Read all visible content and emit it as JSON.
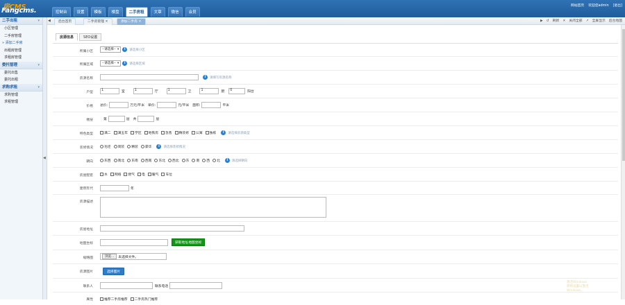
{
  "logo": {
    "top": "房CMS",
    "bottom": "Fangcms."
  },
  "nav": [
    "控制台",
    "设置",
    "模板",
    "楼盘",
    "二手房租",
    "文章",
    "微信",
    "会员"
  ],
  "nav_active_index": 4,
  "toplinks": [
    "网站首页",
    "欢迎您admin",
    "[退出]"
  ],
  "sidebar": [
    {
      "title": "二手出租",
      "items": [
        "小区管理",
        "二手房管理",
        "添加二手房",
        "出租房管理",
        "求租房管理"
      ],
      "active": "添加二手房"
    },
    {
      "title": "委托管理",
      "items": [
        "委托出售",
        "委托出租"
      ]
    },
    {
      "title": "求购求租",
      "items": [
        "求购管理",
        "求租管理"
      ]
    }
  ],
  "page_tabs": [
    "后台首页",
    "二手房管理",
    "添加二手房"
  ],
  "tab_tools": [
    "↺",
    "刷新",
    "✕",
    "关闭全部",
    "↗",
    "全屏显示",
    "后台地图"
  ],
  "subtabs": [
    "房源信息",
    "SEO设置"
  ],
  "form": {
    "community": {
      "label": "所属小区",
      "select": "--请选择--",
      "hint": "请选择小区"
    },
    "region": {
      "label": "所属区域",
      "select": "--请选择--",
      "hint": "请选择区域"
    },
    "title": {
      "label": "房源名称",
      "hint": "请填写房源名称"
    },
    "layout": {
      "label": "户型",
      "units": [
        "室",
        "厅",
        "卫",
        "厨",
        "阳台"
      ],
      "values": [
        "1",
        "1",
        "1",
        "1",
        "0"
      ]
    },
    "price": {
      "label": "价格",
      "total_label": "总价:",
      "unit_label": "万元/平米",
      "unit_price_label": "单价:",
      "yuan_label": "元/平米",
      "area_label": "面积:",
      "sqm_label": "平米"
    },
    "floor": {
      "label": "楼层",
      "nth": "第",
      "floor": "层",
      "total": "共",
      "layer": "层"
    },
    "features": {
      "label": "特色类型",
      "options": [
        "满二",
        "满五年",
        "学区",
        "地铁房",
        "急售",
        "精装修",
        "公寓",
        "独栋"
      ],
      "hint": "请选择房源类型"
    },
    "decoration": {
      "label": "装修情况",
      "options": [
        "毛坯",
        "简装",
        "精装",
        "豪华"
      ],
      "hint": "请选择装修情况"
    },
    "orientation": {
      "label": "朝向",
      "options": [
        "东西",
        "南北",
        "东南",
        "西南",
        "东北",
        "西北",
        "东",
        "南",
        "西",
        "北"
      ],
      "hint": "请选择朝向"
    },
    "facilities": {
      "label": "房屋配套",
      "options": [
        "水",
        "网络",
        "燃气",
        "电",
        "暖气",
        "车位"
      ]
    },
    "build_year": {
      "label": "建筑年代",
      "unit": "年"
    },
    "description": {
      "label": "房源描述"
    },
    "address": {
      "label": "房屋地址"
    },
    "coords": {
      "label": "地图坐标",
      "button": "获取地址地图坐标"
    },
    "thumbnail": {
      "label": "缩略图",
      "browse": "浏览...",
      "file_text": "未选择文件。"
    },
    "photos": {
      "label": "房源图片",
      "button": "选择图片"
    },
    "contact": {
      "label": "联系人",
      "phone_label": "联系电话"
    },
    "attributes": {
      "label": "属性",
      "options": [
        "推荐二手房推荐",
        "二手房热门推荐"
      ]
    }
  },
  "watermark": "激活Windows\n转到设置以激活Windows。"
}
